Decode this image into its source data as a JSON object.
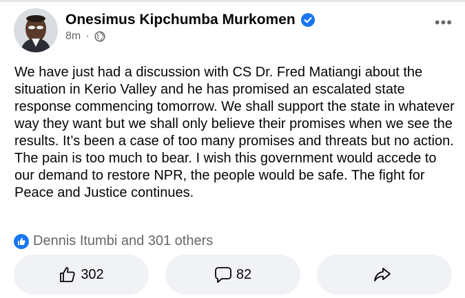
{
  "post": {
    "author": "Onesimus Kipchumba Murkomen",
    "time": "8m",
    "separator": "·",
    "body": "We have just had a discussion with CS Dr. Fred Matiangi about the situation in Kerio Valley and he has promised an escalated state response commencing tomorrow. We shall support the state in whatever way they want but we shall only believe their promises when we see the results. It’s been a case of too many promises and threats but no action. The pain is too much to bear. I wish this government would accede to our demand to restore NPR, the people would be safe. The fight for Peace and Justice continues."
  },
  "reactions": {
    "summary": "Dennis Itumbi and 301 others"
  },
  "actions": {
    "like_count": "302",
    "comment_count": "82"
  },
  "icons": {
    "verified": "verified-badge-icon",
    "audience": "globe-icon",
    "more": "more-options-icon",
    "like_badge": "like-reaction-icon",
    "like": "thumbs-up-icon",
    "comment": "comment-bubble-icon",
    "share": "share-arrow-icon"
  },
  "colors": {
    "brand_blue": "#1877f2",
    "secondary_text": "#65676b",
    "button_bg": "#f0f2f5"
  }
}
